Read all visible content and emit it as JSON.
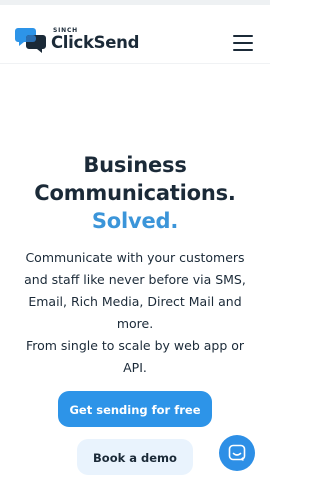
{
  "header": {
    "logo": {
      "brand_small": "SINCH",
      "brand_name": "ClickSend",
      "icon": "chat-bubbles-logo-icon"
    },
    "menu_icon": "hamburger-menu-icon"
  },
  "hero": {
    "headline_line1": "Business",
    "headline_line2": "Communications.",
    "headline_line3": "Solved.",
    "paragraph1": "Communicate with your customers and staff like never before via SMS, Email, Rich Media, Direct Mail and more.",
    "paragraph2": "From single to scale by web app or API.",
    "primary_button": "Get sending for free",
    "secondary_button": "Book a demo"
  },
  "chat_widget": {
    "icon": "chat-icon"
  },
  "colors": {
    "text": "#1b2a38",
    "accent": "#3b95d9",
    "primary_button": "#2d94e8",
    "secondary_button_bg": "#e9f3fd"
  }
}
